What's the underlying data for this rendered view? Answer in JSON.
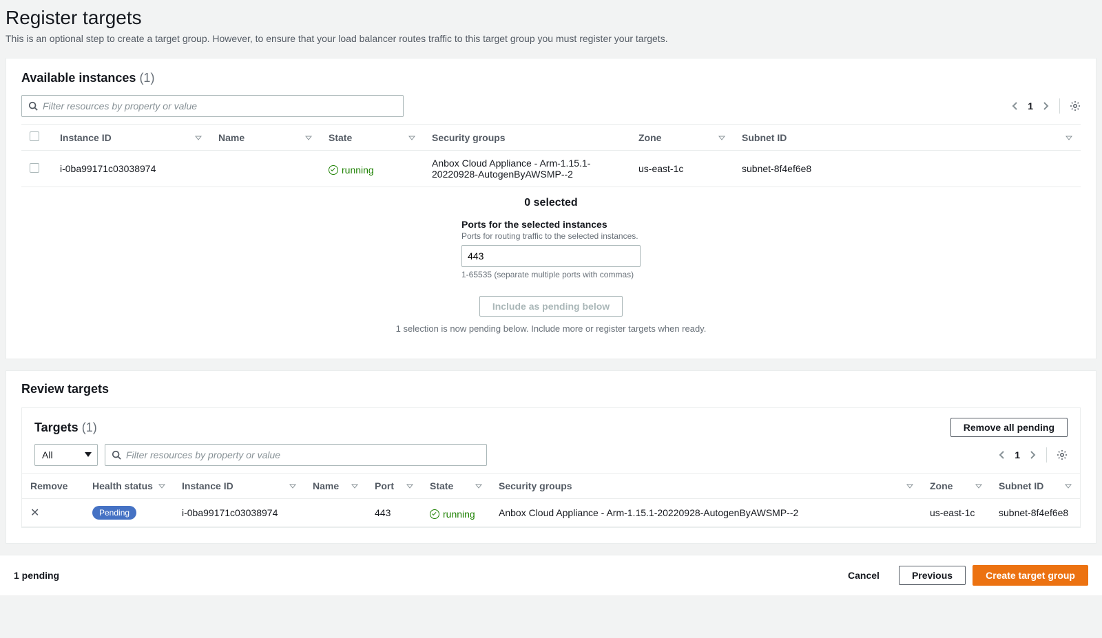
{
  "page": {
    "title": "Register targets",
    "description": "This is an optional step to create a target group. However, to ensure that your load balancer routes traffic to this target group you must register your targets."
  },
  "available": {
    "title": "Available instances",
    "count": "(1)",
    "filter_placeholder": "Filter resources by property or value",
    "page_number": "1",
    "columns": {
      "instance_id": "Instance ID",
      "name": "Name",
      "state": "State",
      "security_groups": "Security groups",
      "zone": "Zone",
      "subnet_id": "Subnet ID"
    },
    "rows": [
      {
        "instance_id": "i-0ba99171c03038974",
        "name": "",
        "state": "running",
        "security_groups": "Anbox Cloud Appliance - Arm-1.15.1-20220928-AutogenByAWSMP--2",
        "zone": "us-east-1c",
        "subnet_id": "subnet-8f4ef6e8"
      }
    ],
    "selected_text": "0 selected",
    "ports_label": "Ports for the selected instances",
    "ports_sub": "Ports for routing traffic to the selected instances.",
    "ports_value": "443",
    "ports_hint": "1-65535 (separate multiple ports with commas)",
    "include_button": "Include as pending below",
    "pending_message": "1 selection is now pending below. Include more or register targets when ready."
  },
  "review": {
    "title": "Review targets",
    "targets_title": "Targets",
    "targets_count": "(1)",
    "remove_all_label": "Remove all pending",
    "dropdown_value": "All",
    "filter_placeholder": "Filter resources by property or value",
    "page_number": "1",
    "columns": {
      "remove": "Remove",
      "health": "Health status",
      "instance_id": "Instance ID",
      "name": "Name",
      "port": "Port",
      "state": "State",
      "security_groups": "Security groups",
      "zone": "Zone",
      "subnet_id": "Subnet ID"
    },
    "rows": [
      {
        "health": "Pending",
        "instance_id": "i-0ba99171c03038974",
        "name": "",
        "port": "443",
        "state": "running",
        "security_groups": "Anbox Cloud Appliance - Arm-1.15.1-20220928-AutogenByAWSMP--2",
        "zone": "us-east-1c",
        "subnet_id": "subnet-8f4ef6e8"
      }
    ]
  },
  "footer": {
    "pending_text": "1 pending",
    "cancel": "Cancel",
    "previous": "Previous",
    "create": "Create target group"
  }
}
